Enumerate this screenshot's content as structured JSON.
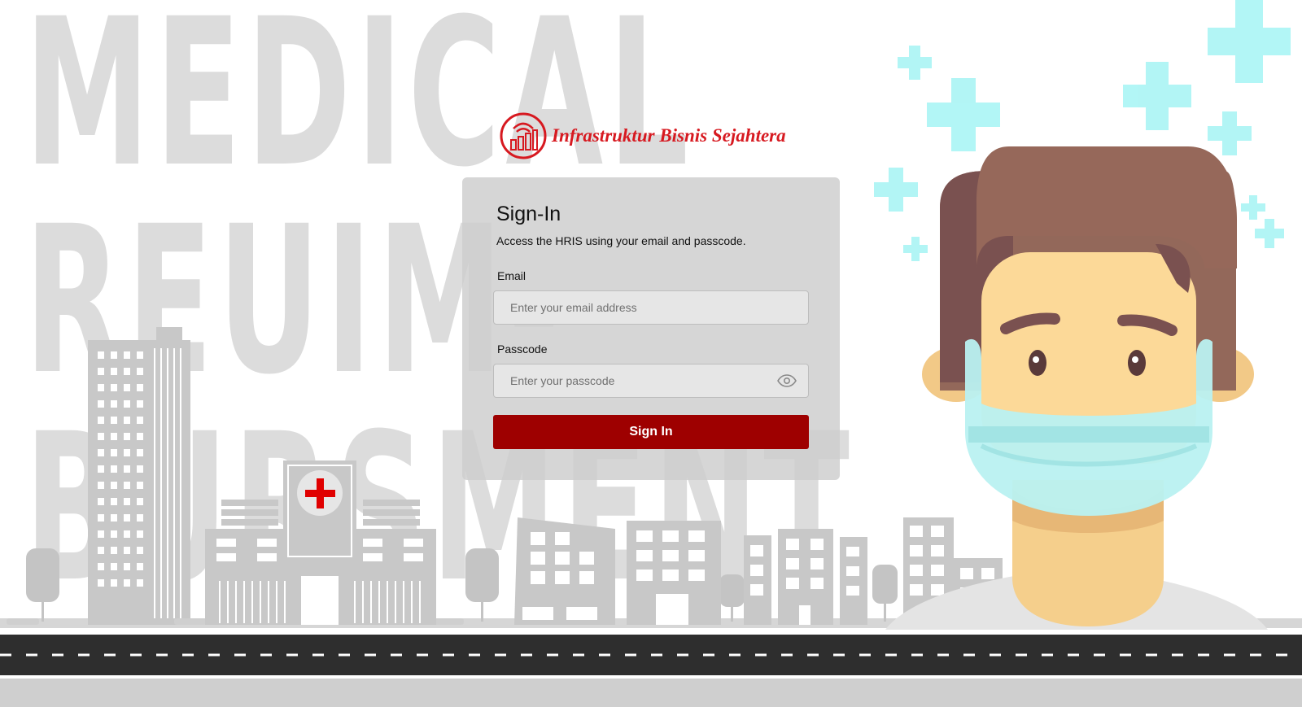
{
  "background": {
    "words": [
      "MEDICAL",
      "REUIM-",
      "BURSMENT"
    ]
  },
  "brand": {
    "name": "Infrastruktur Bisnis Sejahtera",
    "logo_icon": "signal-building-icon",
    "color": "#d71920"
  },
  "signin": {
    "title": "Sign-In",
    "subtitle": "Access the HRIS using your email and passcode.",
    "email_label": "Email",
    "email_placeholder": "Enter your email address",
    "email_value": "",
    "passcode_label": "Passcode",
    "passcode_placeholder": "Enter your passcode",
    "passcode_value": "",
    "passcode_toggle_icon": "eye-icon",
    "button_label": "Sign In",
    "button_color": "#9e0000"
  }
}
